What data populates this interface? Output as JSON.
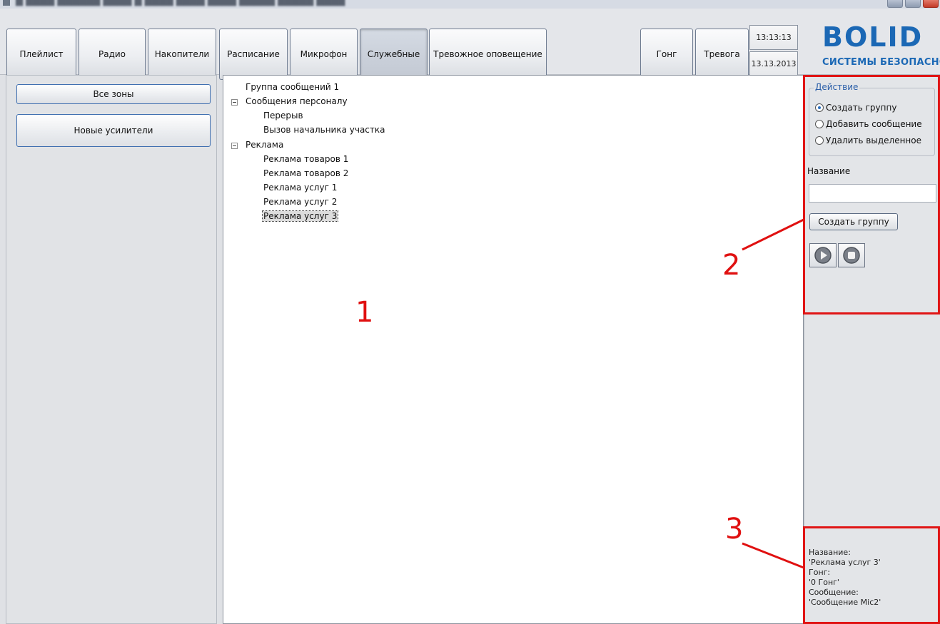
{
  "toolbar": {
    "buttons": [
      "Плейлист",
      "Радио",
      "Накопители",
      "Расписание",
      "Микрофон",
      "Служебные",
      "Тревожное оповещение"
    ],
    "active": "Служебные",
    "gong": "Гонг",
    "alarm": "Тревога",
    "time": "13:13:13",
    "date": "13.13.2013"
  },
  "logo": {
    "mark": "BOLID",
    "subtitle": "СИСТЕМЫ БЕЗОПАСНОСТИ"
  },
  "left": {
    "all_zones": "Все зоны",
    "new_amps": "Новые усилители"
  },
  "tree": {
    "group1": "Группа сообщений 1",
    "staff": "Сообщения персоналу",
    "staff_items": [
      "Перерыв",
      "Вызов начальника участка"
    ],
    "ads": "Реклама",
    "ads_items": [
      "Реклама товаров 1",
      "Реклама товаров 2",
      "Реклама услуг 1",
      "Реклама услуг 2",
      "Реклама услуг 3"
    ],
    "selected": "Реклама услуг 3"
  },
  "right": {
    "action_legend": "Действие",
    "radios": [
      "Создать группу",
      "Добавить сообщение",
      "Удалить выделенное"
    ],
    "checked_radio": "Создать группу",
    "name_label": "Название",
    "name_value": "",
    "create_button": "Создать группу",
    "info": [
      "Название:",
      "'Реклама услуг 3'",
      "Гонг:",
      "'0 Гонг'",
      "Сообщение:",
      "'Сообщение Mic2'"
    ]
  },
  "callouts": [
    "1",
    "2",
    "3"
  ],
  "colors": {
    "callout": "#e01010",
    "accent": "#1b68b5"
  }
}
